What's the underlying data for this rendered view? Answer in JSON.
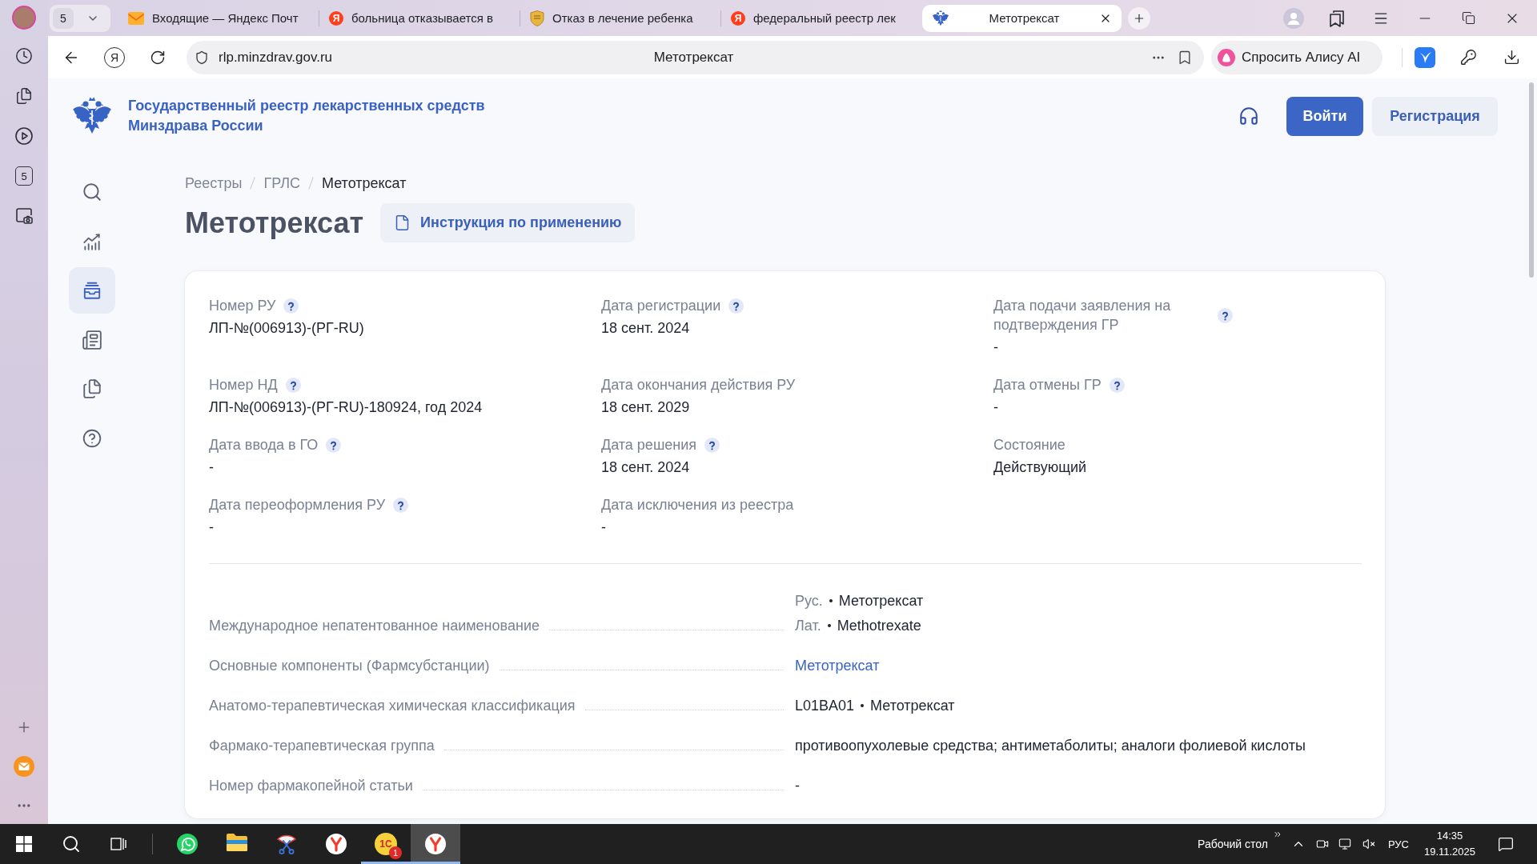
{
  "browser": {
    "sidebar_counter": "5",
    "tab_group_count": "5",
    "tabs": [
      {
        "title": "Входящие — Яндекс Почт",
        "kind": "mail",
        "selected": false
      },
      {
        "title": "больница отказывается в",
        "kind": "letter",
        "icon_text": "Я",
        "selected": false
      },
      {
        "title": "Отказ в лечение ребенка",
        "kind": "shield",
        "selected": false
      },
      {
        "title": "федеральный реестр лек",
        "kind": "letter",
        "icon_text": "Я",
        "selected": false
      },
      {
        "title": "Метотрексат",
        "kind": "emblem",
        "selected": true
      }
    ],
    "address_bar": {
      "home_letter": "Я",
      "url": "rlp.minzdrav.gov.ru",
      "page_title": "Метотрексат"
    },
    "assistant_button": "Спросить Алису AI"
  },
  "site_header": {
    "title_lines": [
      "Государственный реестр лекарственных средств",
      "Минздрава России"
    ],
    "login_button": "Войти",
    "register_button": "Регистрация"
  },
  "nav": [
    {
      "kind": "search",
      "selected": false
    },
    {
      "kind": "chart",
      "selected": false
    },
    {
      "kind": "registry",
      "selected": true
    },
    {
      "kind": "news",
      "selected": false
    },
    {
      "kind": "documents",
      "selected": false
    },
    {
      "kind": "help",
      "selected": false
    }
  ],
  "breadcrumbs": [
    {
      "label": "Реестры",
      "current": false
    },
    {
      "label": "ГРЛС",
      "current": false
    },
    {
      "label": "Метотрексат",
      "current": true
    }
  ],
  "title": "Метотрексат",
  "instruction_button": "Инструкция по применению",
  "registration": [
    {
      "label": "Номер РУ",
      "value": "ЛП-№(006913)-(РГ-RU)",
      "help": true
    },
    {
      "label": "Дата регистрации",
      "value": "18 сент. 2024",
      "help": true
    },
    {
      "label": "Дата подачи заявления на подтверждения ГР",
      "value": "-",
      "help": true
    },
    {
      "label": "Номер НД",
      "value": "ЛП-№(006913)-(РГ-RU)-180924, год 2024",
      "help": true
    },
    {
      "label": "Дата окончания действия РУ",
      "value": "18 сент. 2029",
      "help": false
    },
    {
      "label": "Дата отмены ГР",
      "value": "-",
      "help": true
    },
    {
      "label": "Дата ввода в ГО",
      "value": "-",
      "help": true
    },
    {
      "label": "Дата решения",
      "value": "18 сент. 2024",
      "help": true
    },
    {
      "label": "Состояние",
      "value": "Действующий",
      "help": false
    },
    {
      "label": "Дата переоформления РУ",
      "value": "-",
      "help": true
    },
    {
      "label": "Дата исключения из реестра",
      "value": "-",
      "help": false
    }
  ],
  "details": [
    {
      "label": "Международное непатентованное наименование",
      "kind": "names",
      "names": [
        {
          "lang": "Рус.",
          "value": "Метотрексат"
        },
        {
          "lang": "Лат.",
          "value": "Methotrexate"
        }
      ]
    },
    {
      "label": "Основные компоненты (Фармсубстанции)",
      "kind": "link",
      "value": "Метотрексат"
    },
    {
      "label": "Анатомо-терапевтическая химическая классификация",
      "kind": "code",
      "code": "L01BA01",
      "value": "Метотрексат"
    },
    {
      "label": "Фармако-терапевтическая группа",
      "kind": "text",
      "value": "противоопухолевые средства; антиметаболиты; аналоги фолиевой кислоты"
    },
    {
      "label": "Номер фармакопейной статьи",
      "kind": "text",
      "value": "-"
    }
  ],
  "taskbar": {
    "apps": [
      {
        "kind": "chat",
        "running": false,
        "selected": false
      },
      {
        "kind": "folder",
        "running": false,
        "selected": false
      },
      {
        "kind": "scissors",
        "running": false,
        "selected": false
      },
      {
        "kind": "browser",
        "running": false,
        "selected": false
      },
      {
        "kind": "logo",
        "logo_text": "1С",
        "badge": "1",
        "running": true,
        "selected": false
      },
      {
        "kind": "browser",
        "running": true,
        "selected": true
      }
    ],
    "desktop_label": "Рабочий стол",
    "language": "РУС",
    "time": "14:35",
    "date": "19.11.2025"
  }
}
